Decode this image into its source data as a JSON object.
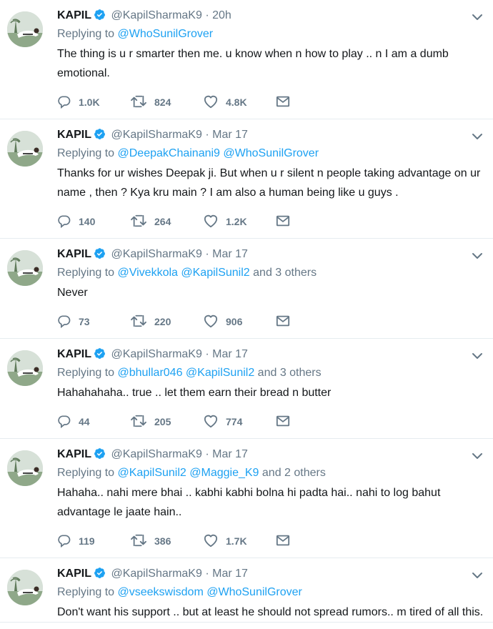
{
  "tweets": [
    {
      "name": "KAPIL",
      "handle": "@KapilSharmaK9",
      "separator": "·",
      "time": "20h",
      "replying_label": "Replying to",
      "mentions": [
        "@WhoSunilGrover"
      ],
      "others": "",
      "text": "The thing is u r smarter then me. u know when n how to play .. n I am a dumb emotional.",
      "replies": "1.0K",
      "retweets": "824",
      "likes": "4.8K"
    },
    {
      "name": "KAPIL",
      "handle": "@KapilSharmaK9",
      "separator": "·",
      "time": "Mar 17",
      "replying_label": "Replying to",
      "mentions": [
        "@DeepakChainani9",
        "@WhoSunilGrover"
      ],
      "others": "",
      "text": "Thanks for ur wishes Deepak ji. But when u r silent n people taking advantage on ur name , then ? Kya kru main ? I am also a human being like u guys .",
      "replies": "140",
      "retweets": "264",
      "likes": "1.2K"
    },
    {
      "name": "KAPIL",
      "handle": "@KapilSharmaK9",
      "separator": "·",
      "time": "Mar 17",
      "replying_label": "Replying to",
      "mentions": [
        "@Vivekkola",
        "@KapilSunil2"
      ],
      "others": "and 3 others",
      "text": "Never",
      "replies": "73",
      "retweets": "220",
      "likes": "906"
    },
    {
      "name": "KAPIL",
      "handle": "@KapilSharmaK9",
      "separator": "·",
      "time": "Mar 17",
      "replying_label": "Replying to",
      "mentions": [
        "@bhullar046",
        "@KapilSunil2"
      ],
      "others": "and 3 others",
      "text": "Hahahahaha.. true .. let them earn their bread n butter",
      "replies": "44",
      "retweets": "205",
      "likes": "774"
    },
    {
      "name": "KAPIL",
      "handle": "@KapilSharmaK9",
      "separator": "·",
      "time": "Mar 17",
      "replying_label": "Replying to",
      "mentions": [
        "@KapilSunil2",
        "@Maggie_K9"
      ],
      "others": "and 2 others",
      "text": "Hahaha.. nahi mere bhai .. kabhi kabhi bolna hi padta hai.. nahi to log bahut advantage le jaate hain..",
      "replies": "119",
      "retweets": "386",
      "likes": "1.7K"
    },
    {
      "name": "KAPIL",
      "handle": "@KapilSharmaK9",
      "separator": "·",
      "time": "Mar 17",
      "replying_label": "Replying to",
      "mentions": [
        "@vseekswisdom",
        "@WhoSunilGrover"
      ],
      "others": "",
      "text": "Don't want his support .. but at least he should not spread rumors.. m tired of all this.",
      "replies": "",
      "retweets": "",
      "likes": ""
    }
  ],
  "icons": {
    "verified": "verified-badge-icon",
    "caret": "chevron-down-icon",
    "reply": "reply-icon",
    "retweet": "retweet-icon",
    "like": "heart-icon",
    "message": "mail-icon"
  },
  "colors": {
    "link": "#1da1f2",
    "secondary": "#657786",
    "text": "#14171a",
    "divider": "#e6ecf0"
  }
}
